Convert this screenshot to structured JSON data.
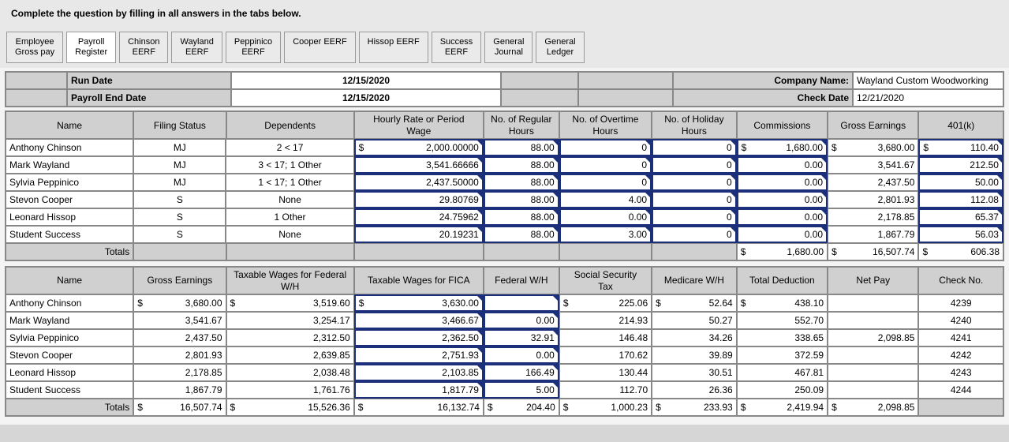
{
  "instructions": "Complete the question by filling in all answers in the tabs below.",
  "tabs": [
    {
      "l1": "Employee",
      "l2": "Gross pay"
    },
    {
      "l1": "Payroll",
      "l2": "Register"
    },
    {
      "l1": "Chinson",
      "l2": "EERF"
    },
    {
      "l1": "Wayland",
      "l2": "EERF"
    },
    {
      "l1": "Peppinico",
      "l2": "EERF"
    },
    {
      "l1": "Cooper EERF",
      "l2": ""
    },
    {
      "l1": "Hissop EERF",
      "l2": ""
    },
    {
      "l1": "Success",
      "l2": "EERF"
    },
    {
      "l1": "General",
      "l2": "Journal"
    },
    {
      "l1": "General",
      "l2": "Ledger"
    }
  ],
  "active_tab_index": 1,
  "hdr": {
    "run_date_label": "Run Date",
    "run_date_value": "12/15/2020",
    "end_date_label": "Payroll End Date",
    "end_date_value": "12/15/2020",
    "company_label": "Company Name:",
    "company_value": "Wayland Custom Woodworking",
    "check_date_label": "Check Date",
    "check_date_value": "12/21/2020"
  },
  "t1": {
    "headers": {
      "name": "Name",
      "filing": "Filing Status",
      "dep": "Dependents",
      "rate_l1": "Hourly Rate or Period",
      "rate_l2": "Wage",
      "reg_l1": "No. of Regular",
      "reg_l2": "Hours",
      "ot_l1": "No. of Overtime",
      "ot_l2": "Hours",
      "hol_l1": "No. of Holiday",
      "hol_l2": "Hours",
      "comm": "Commissions",
      "ge": "Gross Earnings",
      "k401": "401(k)",
      "totals": "Totals"
    },
    "rows": [
      {
        "name": "Anthony Chinson",
        "fs": "MJ",
        "dep": "2 < 17",
        "rate_sym": "$",
        "rate": "2,000.00000",
        "reg": "88.00",
        "ot": "0",
        "hol": "0",
        "comm_sym": "$",
        "comm": "1,680.00",
        "ge_sym": "$",
        "ge": "3,680.00",
        "k_sym": "$",
        "k": "110.40"
      },
      {
        "name": "Mark Wayland",
        "fs": "MJ",
        "dep": "3 < 17; 1 Other",
        "rate_sym": "",
        "rate": "3,541.66666",
        "reg": "88.00",
        "ot": "0",
        "hol": "0",
        "comm_sym": "",
        "comm": "0.00",
        "ge_sym": "",
        "ge": "3,541.67",
        "k_sym": "",
        "k": "212.50"
      },
      {
        "name": "Sylvia Peppinico",
        "fs": "MJ",
        "dep": "1 < 17; 1 Other",
        "rate_sym": "",
        "rate": "2,437.50000",
        "reg": "88.00",
        "ot": "0",
        "hol": "0",
        "comm_sym": "",
        "comm": "0.00",
        "ge_sym": "",
        "ge": "2,437.50",
        "k_sym": "",
        "k": "50.00"
      },
      {
        "name": "Stevon Cooper",
        "fs": "S",
        "dep": "None",
        "rate_sym": "",
        "rate": "29.80769",
        "reg": "88.00",
        "ot": "4.00",
        "hol": "0",
        "comm_sym": "",
        "comm": "0.00",
        "ge_sym": "",
        "ge": "2,801.93",
        "k_sym": "",
        "k": "112.08"
      },
      {
        "name": "Leonard Hissop",
        "fs": "S",
        "dep": "1 Other",
        "rate_sym": "",
        "rate": "24.75962",
        "reg": "88.00",
        "ot": "0.00",
        "hol": "0",
        "comm_sym": "",
        "comm": "0.00",
        "ge_sym": "",
        "ge": "2,178.85",
        "k_sym": "",
        "k": "65.37"
      },
      {
        "name": "Student Success",
        "fs": "S",
        "dep": "None",
        "rate_sym": "",
        "rate": "20.19231",
        "reg": "88.00",
        "ot": "3.00",
        "hol": "0",
        "comm_sym": "",
        "comm": "0.00",
        "ge_sym": "",
        "ge": "1,867.79",
        "k_sym": "",
        "k": "56.03"
      }
    ],
    "totals": {
      "comm_sym": "$",
      "comm": "1,680.00",
      "ge_sym": "$",
      "ge": "16,507.74",
      "k_sym": "$",
      "k": "606.38"
    }
  },
  "t2": {
    "headers": {
      "name": "Name",
      "ge": "Gross Earnings",
      "fw_l1": "Taxable Wages for Federal",
      "fw_l2": "W/H",
      "fica": "Taxable Wages for FICA",
      "fed": "Federal W/H",
      "ss_l1": "Social Security",
      "ss_l2": "Tax",
      "med": "Medicare W/H",
      "td": "Total Deduction",
      "np": "Net Pay",
      "ck": "Check No.",
      "totals": "Totals"
    },
    "rows": [
      {
        "name": "Anthony Chinson",
        "ge_sym": "$",
        "ge": "3,680.00",
        "fw_sym": "$",
        "fw": "3,519.60",
        "fica_sym": "$",
        "fica": "3,630.00",
        "fed": "",
        "ss_sym": "$",
        "ss": "225.06",
        "med_sym": "$",
        "med": "52.64",
        "td_sym": "$",
        "td": "438.10",
        "np": "",
        "ck": "4239"
      },
      {
        "name": "Mark Wayland",
        "ge_sym": "",
        "ge": "3,541.67",
        "fw_sym": "",
        "fw": "3,254.17",
        "fica_sym": "",
        "fica": "3,466.67",
        "fed": "0.00",
        "ss_sym": "",
        "ss": "214.93",
        "med_sym": "",
        "med": "50.27",
        "td_sym": "",
        "td": "552.70",
        "np": "",
        "ck": "4240"
      },
      {
        "name": "Sylvia Peppinico",
        "ge_sym": "",
        "ge": "2,437.50",
        "fw_sym": "",
        "fw": "2,312.50",
        "fica_sym": "",
        "fica": "2,362.50",
        "fed": "32.91",
        "ss_sym": "",
        "ss": "146.48",
        "med_sym": "",
        "med": "34.26",
        "td_sym": "",
        "td": "338.65",
        "np": "2,098.85",
        "ck": "4241"
      },
      {
        "name": "Stevon Cooper",
        "ge_sym": "",
        "ge": "2,801.93",
        "fw_sym": "",
        "fw": "2,639.85",
        "fica_sym": "",
        "fica": "2,751.93",
        "fed": "0.00",
        "ss_sym": "",
        "ss": "170.62",
        "med_sym": "",
        "med": "39.89",
        "td_sym": "",
        "td": "372.59",
        "np": "",
        "ck": "4242"
      },
      {
        "name": "Leonard Hissop",
        "ge_sym": "",
        "ge": "2,178.85",
        "fw_sym": "",
        "fw": "2,038.48",
        "fica_sym": "",
        "fica": "2,103.85",
        "fed": "166.49",
        "ss_sym": "",
        "ss": "130.44",
        "med_sym": "",
        "med": "30.51",
        "td_sym": "",
        "td": "467.81",
        "np": "",
        "ck": "4243"
      },
      {
        "name": "Student Success",
        "ge_sym": "",
        "ge": "1,867.79",
        "fw_sym": "",
        "fw": "1,761.76",
        "fica_sym": "",
        "fica": "1,817.79",
        "fed": "5.00",
        "ss_sym": "",
        "ss": "112.70",
        "med_sym": "",
        "med": "26.36",
        "td_sym": "",
        "td": "250.09",
        "np": "",
        "ck": "4244"
      }
    ],
    "totals": {
      "ge_sym": "$",
      "ge": "16,507.74",
      "fw_sym": "$",
      "fw": "15,526.36",
      "fica_sym": "$",
      "fica": "16,132.74",
      "fed_sym": "$",
      "fed": "204.40",
      "ss_sym": "$",
      "ss": "1,000.23",
      "med_sym": "$",
      "med": "233.93",
      "td_sym": "$",
      "td": "2,419.94",
      "np_sym": "$",
      "np": "2,098.85"
    }
  }
}
